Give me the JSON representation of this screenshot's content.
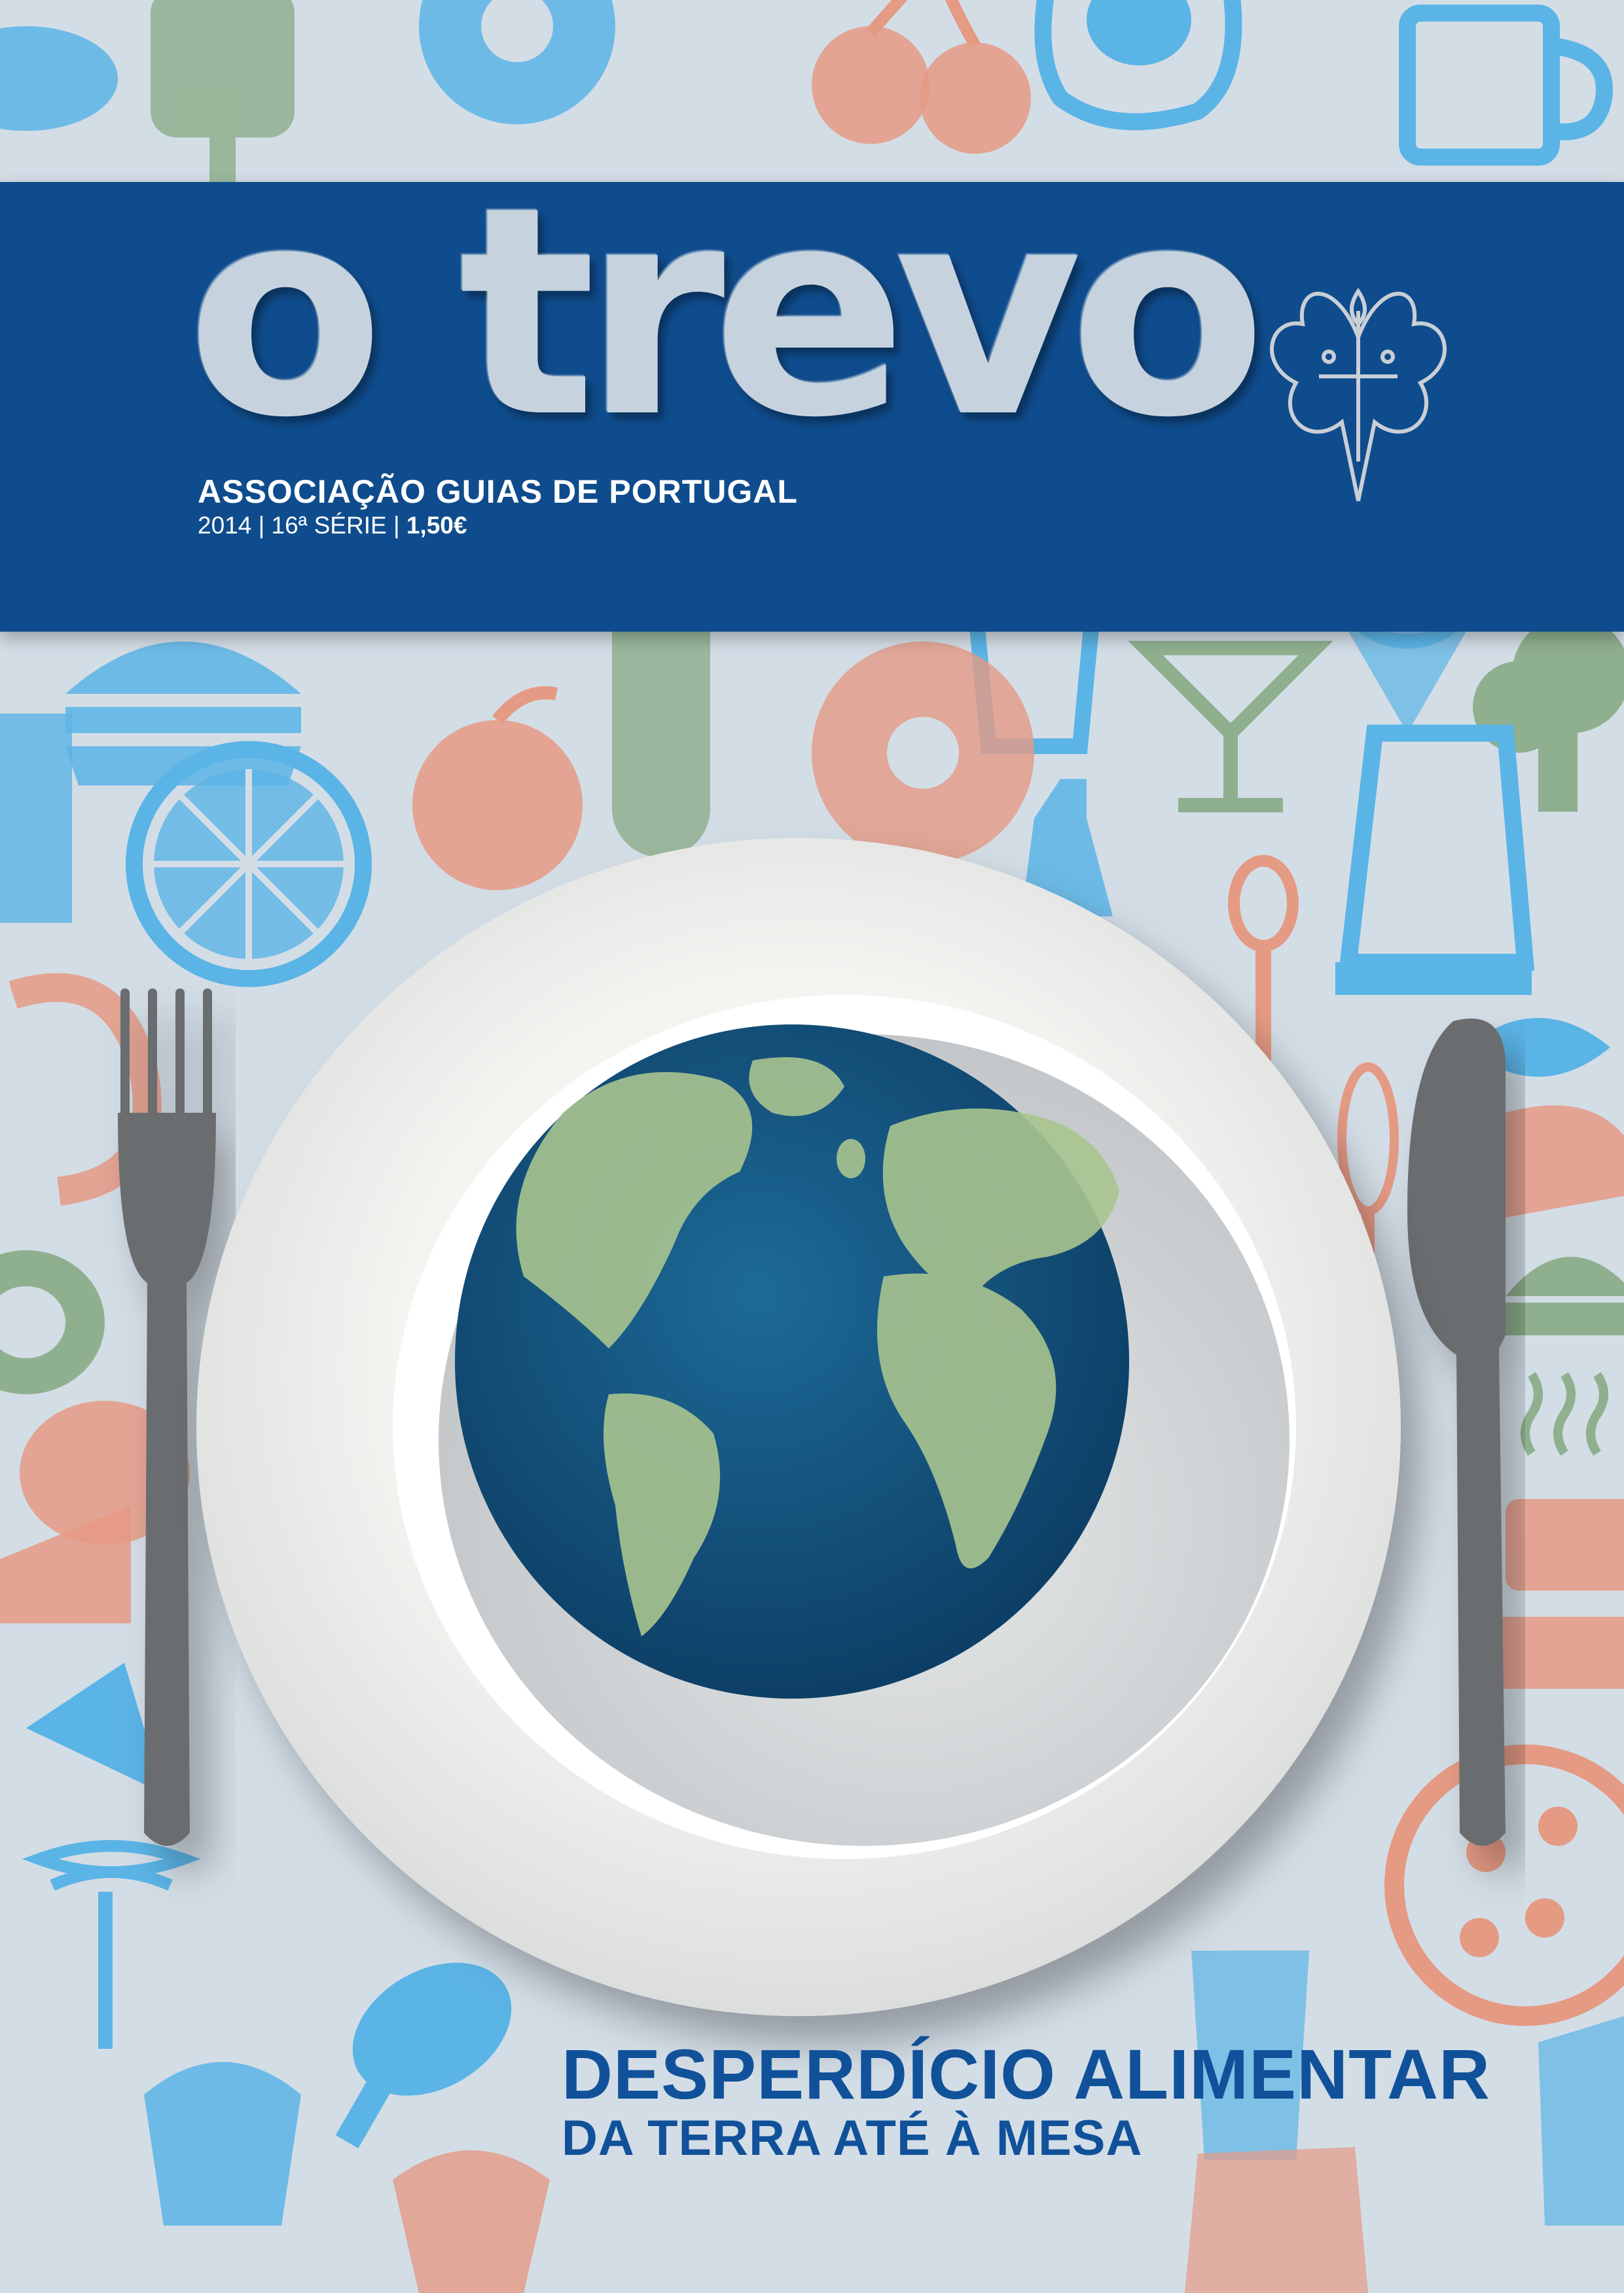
{
  "magazine": {
    "title": "o trevo",
    "association": "ASSOCIAÇÃO GUIAS DE PORTUGAL",
    "year": "2014",
    "series": "16ª SÉRIE",
    "price": "1,50€",
    "separator": "|"
  },
  "headline": {
    "main": "DESPERDÍCIO ALIMENTAR",
    "sub": "DA TERRA ATÉ À MESA"
  },
  "colors": {
    "background": "#d3dde6",
    "masthead": "#0f4c8d",
    "title_text": "#c6d3de",
    "headline": "#10519a",
    "icon_blue": "#5bb4e6",
    "icon_salmon": "#e59a84",
    "icon_green": "#8fb08f",
    "plate": "#f1f1ee",
    "globe_ocean": "#16527f",
    "land": "#a9c48f",
    "cutlery": "#6b6d70"
  },
  "icons": [
    "bread-icon",
    "donut-icon",
    "cherries-icon",
    "fried-egg-icon",
    "beer-mug-icon",
    "ice-pop-icon",
    "hamburger-icon",
    "baguette-icon",
    "drink-glass-icon",
    "ice-cream-cone-icon",
    "broccoli-icon",
    "apple-icon",
    "orange-slice-icon",
    "ham-icon",
    "cocktail-icon",
    "bottle-icon",
    "jug-icon",
    "shrimp-icon",
    "spoon-icon",
    "fish-icon",
    "bread-slice-icon",
    "cake-icon",
    "pizza-icon",
    "chicken-leg-icon",
    "whisk-icon",
    "sushi-icon",
    "cheese-icon",
    "cupcake-icon"
  ]
}
